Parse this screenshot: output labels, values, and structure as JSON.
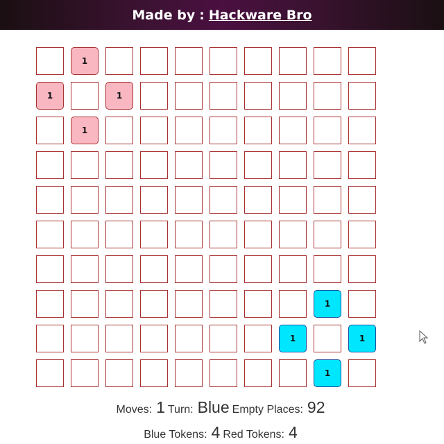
{
  "header": {
    "prefix": "Made by",
    "separator": ":",
    "author": "Hackware Bro"
  },
  "board": {
    "rows": 10,
    "cols": 10,
    "tokens": [
      {
        "row": 0,
        "col": 1,
        "player": "red",
        "value": "1"
      },
      {
        "row": 1,
        "col": 0,
        "player": "red",
        "value": "1"
      },
      {
        "row": 1,
        "col": 2,
        "player": "red",
        "value": "1"
      },
      {
        "row": 2,
        "col": 1,
        "player": "red",
        "value": "1"
      },
      {
        "row": 7,
        "col": 8,
        "player": "blue",
        "value": "1"
      },
      {
        "row": 8,
        "col": 7,
        "player": "blue",
        "value": "1"
      },
      {
        "row": 8,
        "col": 9,
        "player": "blue",
        "value": "1"
      },
      {
        "row": 9,
        "col": 8,
        "player": "blue",
        "value": "1"
      }
    ]
  },
  "status": {
    "moves_label": "Moves:",
    "moves": "1",
    "turn_label": "Turn:",
    "turn": "Blue",
    "empty_label": "Empty Places:",
    "empty": "92",
    "blue_label": "Blue Tokens:",
    "blue": "4",
    "red_label": "Red Tokens:",
    "red": "4"
  },
  "colors": {
    "red_token": "#f9b7c2",
    "blue_token": "#00e6ff",
    "cell_border": "#a83232"
  }
}
